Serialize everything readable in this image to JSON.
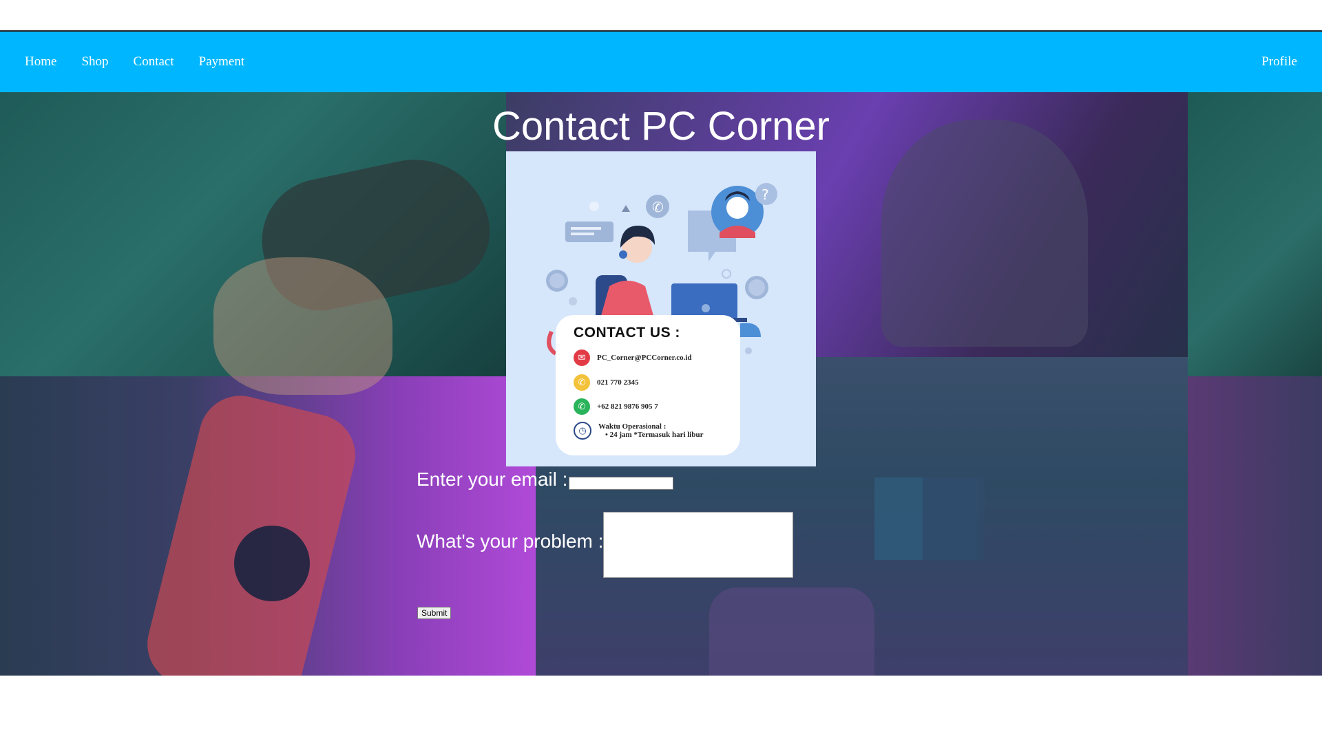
{
  "nav": {
    "items": [
      {
        "label": "Home"
      },
      {
        "label": "Shop"
      },
      {
        "label": "Contact"
      },
      {
        "label": "Payment"
      }
    ],
    "profile_label": "Profile"
  },
  "main": {
    "title": "Contact PC Corner"
  },
  "contact_card": {
    "heading": "CONTACT US :",
    "email": "PC_Corner@PCCorner.co.id",
    "phone": "021 770 2345",
    "whatsapp": "+62 821 9876 905 7",
    "hours_label": "Waktu Operasional :",
    "hours_detail": "• 24 jam *Termasuk hari libur"
  },
  "form": {
    "email_label": "Enter your email :",
    "email_value": "",
    "problem_label": "What's your problem :",
    "problem_value": "",
    "submit_label": "Submit"
  },
  "colors": {
    "navbar": "#00b7ff",
    "card_bg": "#d6e6fb"
  }
}
